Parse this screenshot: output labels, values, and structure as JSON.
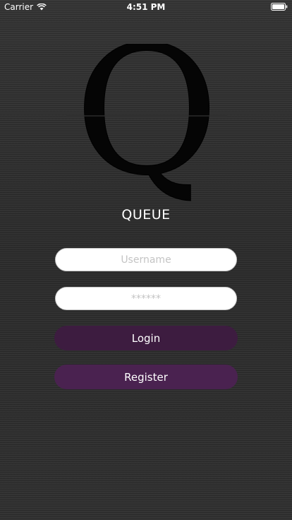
{
  "status_bar": {
    "carrier": "Carrier",
    "time": "4:51 PM"
  },
  "logo": {
    "letter": "Q",
    "title": "QUEUE"
  },
  "form": {
    "username_placeholder": "Username",
    "password_placeholder": "******",
    "login_label": "Login",
    "register_label": "Register"
  },
  "colors": {
    "login_button": "#3d1c40",
    "register_button": "#4a2250",
    "background": "#2e2e2e"
  },
  "icons": {
    "wifi": "wifi-icon",
    "battery": "battery-icon"
  }
}
